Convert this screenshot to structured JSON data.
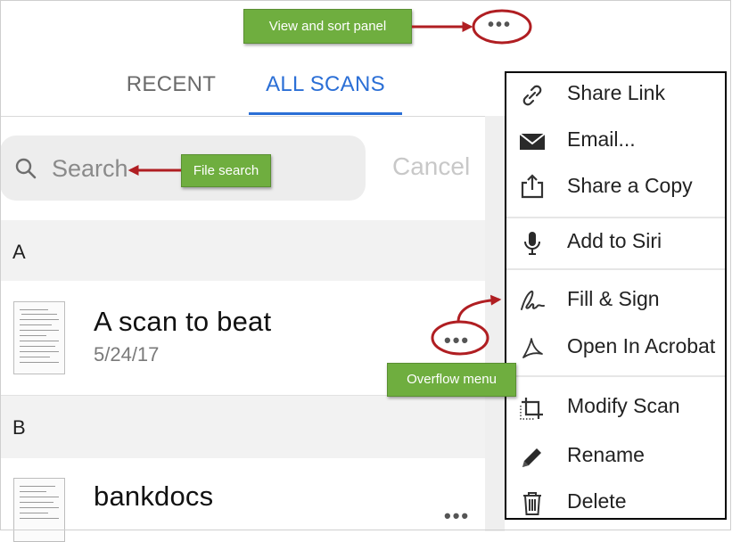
{
  "tabs": {
    "recent": "RECENT",
    "all_scans": "ALL SCANS"
  },
  "search": {
    "placeholder": "Search",
    "cancel": "Cancel"
  },
  "sections": [
    {
      "letter": "A",
      "files": [
        {
          "name": "A scan to beat",
          "date": "5/24/17"
        }
      ]
    },
    {
      "letter": "B",
      "files": [
        {
          "name": "bankdocs",
          "date": ""
        }
      ]
    }
  ],
  "more_glyph": "•••",
  "menu": {
    "items": [
      {
        "label": "Share Link",
        "icon": "link-icon"
      },
      {
        "label": "Email...",
        "icon": "envelope-icon"
      },
      {
        "label": "Share a Copy",
        "icon": "share-icon"
      },
      {
        "label": "Add to Siri",
        "icon": "microphone-icon"
      },
      {
        "label": "Fill & Sign",
        "icon": "signature-icon"
      },
      {
        "label": "Open In Acrobat",
        "icon": "acrobat-icon"
      },
      {
        "label": "Modify Scan",
        "icon": "crop-icon"
      },
      {
        "label": "Rename",
        "icon": "pencil-icon"
      },
      {
        "label": "Delete",
        "icon": "trash-icon"
      }
    ]
  },
  "callouts": {
    "view_sort": "View and sort panel",
    "file_search": "File search",
    "overflow_menu": "Overflow menu"
  },
  "colors": {
    "accent_blue": "#2b6fd6",
    "callout_green": "#6fae3f",
    "annotation_red": "#b01e22"
  }
}
